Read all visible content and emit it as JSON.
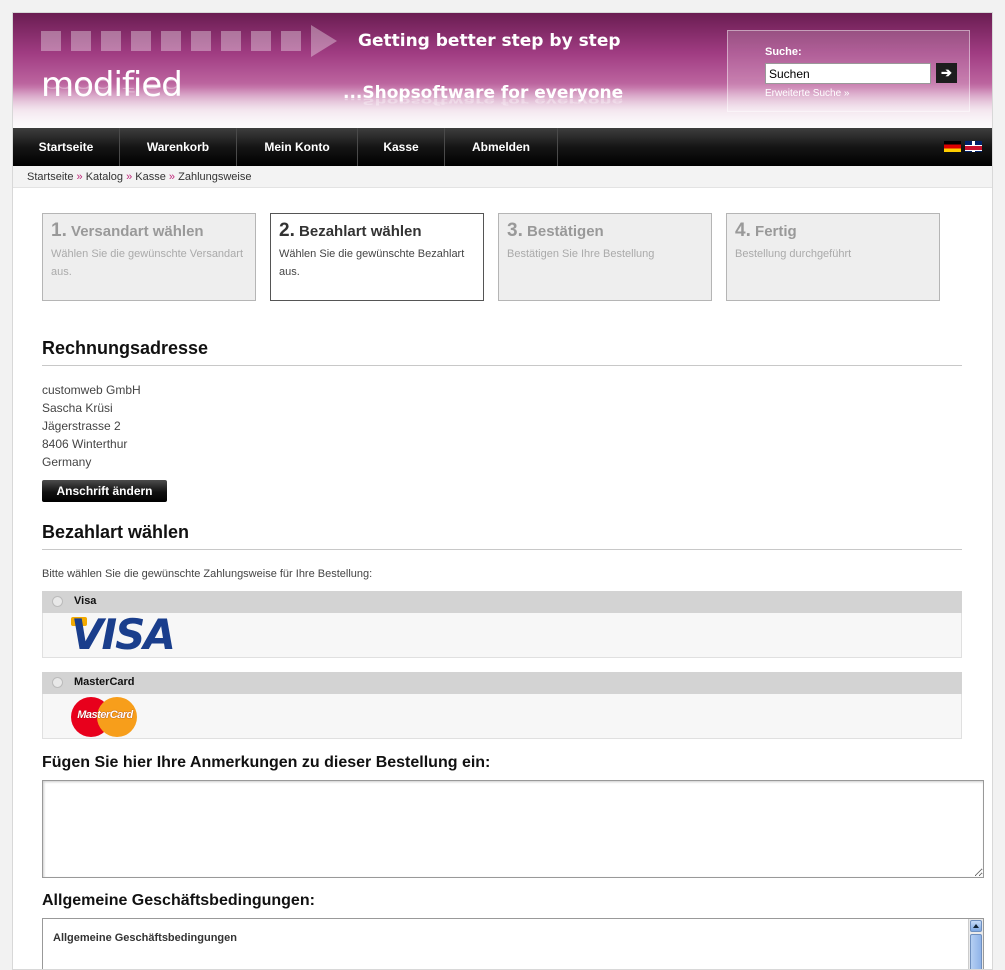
{
  "header": {
    "logo": "modified",
    "slogan_top": "Getting better step by step",
    "slogan_bottom": "...Shopsoftware for everyone",
    "search": {
      "label": "Suche:",
      "value": "Suchen",
      "button": "➔",
      "advanced_link": "Erweiterte Suche »"
    }
  },
  "nav": {
    "items": [
      "Startseite",
      "Warenkorb",
      "Mein Konto",
      "Kasse",
      "Abmelden"
    ],
    "languages": [
      "de-flag-icon",
      "uk-flag-icon"
    ]
  },
  "breadcrumb": {
    "items": [
      "Startseite",
      "Katalog",
      "Kasse",
      "Zahlungsweise"
    ],
    "separator": "»"
  },
  "steps": [
    {
      "num": "1.",
      "title": "Versandart wählen",
      "desc": "Wählen Sie die gewünschte Versandart aus.",
      "active": false
    },
    {
      "num": "2.",
      "title": "Bezahlart wählen",
      "desc": "Wählen Sie die gewünschte Bezahlart aus.",
      "active": true
    },
    {
      "num": "3.",
      "title": "Bestätigen",
      "desc": "Bestätigen Sie Ihre Bestellung",
      "active": false
    },
    {
      "num": "4.",
      "title": "Fertig",
      "desc": "Bestellung durchgeführt",
      "active": false
    }
  ],
  "billing": {
    "heading": "Rechnungsadresse",
    "lines": [
      "customweb GmbH",
      "Sascha Krüsi",
      "Jägerstrasse 2",
      "8406 Winterthur",
      "Germany"
    ],
    "change_button": "Anschrift ändern"
  },
  "payment": {
    "heading": "Bezahlart wählen",
    "intro": "Bitte wählen Sie die gewünschte Zahlungsweise für Ihre Bestellung:",
    "methods": [
      {
        "name": "Visa",
        "logo_text": "VISA",
        "icon": "visa-logo-icon"
      },
      {
        "name": "MasterCard",
        "logo_text": "MasterCard",
        "icon": "mastercard-logo-icon"
      }
    ]
  },
  "comments": {
    "label": "Fügen Sie hier Ihre Anmerkungen zu dieser Bestellung ein:",
    "value": ""
  },
  "terms": {
    "label": "Allgemeine Geschäftsbedingungen:",
    "content_title": "Allgemeine Geschäftsbedingungen"
  },
  "colors": {
    "brand": "#a03c82",
    "nav_bg": "#111111",
    "separator": "#c0297a"
  }
}
